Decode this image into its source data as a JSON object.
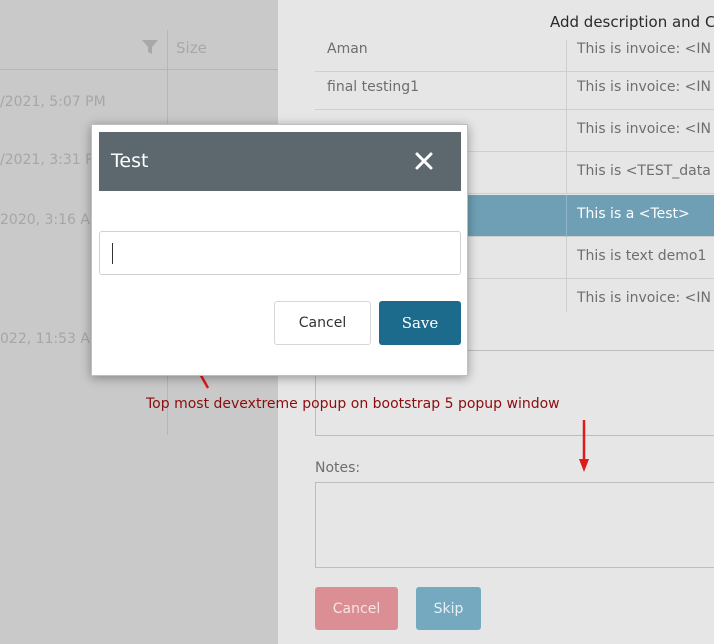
{
  "background_grid": {
    "size_header": "Size",
    "rows": [
      {
        "date": "/2021, 5:07 PM"
      },
      {
        "date": "/2021, 3:31 P"
      },
      {
        "date": "2020, 3:16 A"
      },
      {
        "date": "022, 11:53 A"
      }
    ]
  },
  "right_panel": {
    "title": "Add description and C",
    "rows": [
      {
        "name": "Aman",
        "description": "This is invoice: <IN"
      },
      {
        "name": "final testing1",
        "description": "This is invoice: <IN"
      },
      {
        "name": "",
        "description": "This is invoice: <IN"
      },
      {
        "name": "",
        "description": "This is <TEST_data"
      },
      {
        "name": "",
        "description": "This is a <Test>",
        "selected": true
      },
      {
        "name": "",
        "description": "This is text demo1"
      },
      {
        "name": "",
        "description": "This is invoice: <IN"
      }
    ],
    "notes_label": "Notes:",
    "cancel_label": "Cancel",
    "skip_label": "Skip"
  },
  "popup": {
    "title": "Test",
    "input_value": "",
    "cancel_label": "Cancel",
    "save_label": "Save"
  },
  "annotation": {
    "text": "Top most devextreme popup on bootstrap 5 popup window",
    "color": "#8b0c0c"
  },
  "colors": {
    "popup_title_bar": "#5c676e",
    "save_button": "#1c6b8d",
    "selected_row": "#6f9fb5",
    "arrow": "#e01a1a"
  }
}
